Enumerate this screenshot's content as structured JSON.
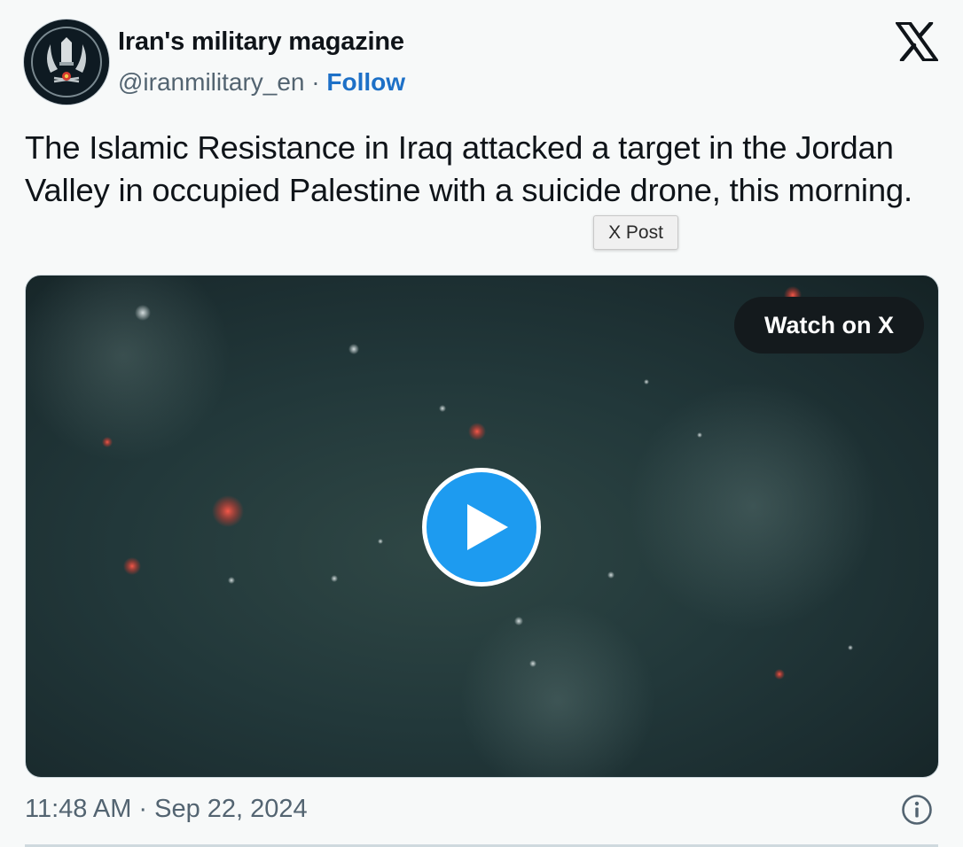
{
  "tweet": {
    "author_name": "Iran's military magazine",
    "handle": "@iranmilitary_en",
    "separator": "·",
    "follow_label": "Follow",
    "text": "The Islamic Resistance in Iraq attacked a target in the Jordan Valley in occupied Palestine with a suicide drone, this morning.",
    "timestamp": "11:48 AM · Sep 22, 2024"
  },
  "tooltip": {
    "text": "X Post"
  },
  "media": {
    "watch_label": "Watch on X"
  },
  "icons": {
    "brand": "x-logo-icon",
    "play": "play-icon",
    "info": "info-icon",
    "avatar": "emblem-avatar"
  },
  "colors": {
    "follow": "#1d70c7",
    "play_button": "#1d9bf0",
    "muted_text": "#536471",
    "background": "#f7f9f9"
  }
}
